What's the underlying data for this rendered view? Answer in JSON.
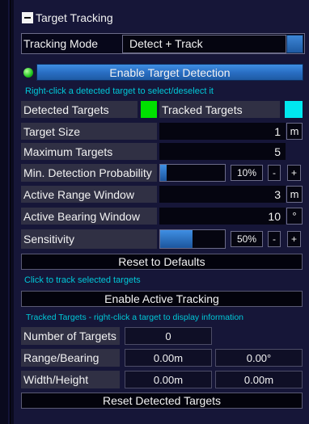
{
  "panel": {
    "title": "Target Tracking",
    "collapse_icon": "minus-square-icon"
  },
  "tracking_mode": {
    "label": "Tracking Mode",
    "value": "Detect + Track"
  },
  "detection": {
    "status_led_color": "#1ec41e",
    "enable_label": "Enable Target Detection",
    "hint": "Right-click a detected target to select/deselect it"
  },
  "legend": {
    "detected_label": "Detected Targets",
    "detected_color": "#00e100",
    "tracked_label": "Tracked Targets",
    "tracked_color": "#00e8f0"
  },
  "settings": {
    "target_size": {
      "label": "Target Size",
      "value": "1",
      "unit": "m"
    },
    "maximum_targets": {
      "label": "Maximum Targets",
      "value": "5"
    },
    "min_detection_probability": {
      "label": "Min. Detection Probability",
      "percent": "10%",
      "fraction": 0.1,
      "minus": "-",
      "plus": "+"
    },
    "active_range_window": {
      "label": "Active Range Window",
      "value": "3",
      "unit": "m"
    },
    "active_bearing_window": {
      "label": "Active Bearing Window",
      "value": "10",
      "unit": "°"
    },
    "sensitivity": {
      "label": "Sensitivity",
      "percent": "50%",
      "fraction": 0.5,
      "minus": "-",
      "plus": "+"
    }
  },
  "reset_defaults_label": "Reset to Defaults",
  "tracking": {
    "hint": "Click to track selected targets",
    "enable_label": "Enable Active Tracking",
    "info_hint": "Tracked Targets - right-click a target to display information"
  },
  "stats": {
    "number_of_targets": {
      "label": "Number of Targets",
      "value": "0"
    },
    "range_bearing": {
      "label": "Range/Bearing",
      "range": "0.00m",
      "bearing": "0.00°"
    },
    "width_height": {
      "label": "Width/Height",
      "width": "0.00m",
      "height": "0.00m"
    }
  },
  "reset_detected_label": "Reset Detected Targets",
  "colors": {
    "accent": "#2a6fc4",
    "hint_text": "#00c8d8",
    "background": "#161638"
  }
}
